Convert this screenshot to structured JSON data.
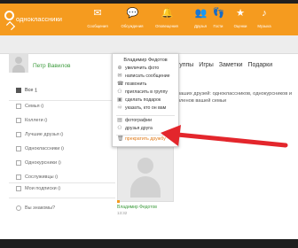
{
  "app": {
    "logo_text": "одноклассники"
  },
  "nav": [
    {
      "label": "Сообщения",
      "icon": "envelope-icon"
    },
    {
      "label": "Обсуждения",
      "icon": "chat-icon"
    },
    {
      "label": "Оповещения",
      "icon": "bell-icon"
    },
    {
      "label": "Друзья",
      "icon": "friends-icon"
    },
    {
      "label": "Гости",
      "icon": "footprints-icon"
    },
    {
      "label": "Оценки",
      "icon": "star-icon"
    },
    {
      "label": "Музыка",
      "icon": "music-icon"
    }
  ],
  "profile": {
    "name": "Петр Вавилов",
    "tabs": [
      "Группы",
      "Игры",
      "Заметки",
      "Подарки"
    ]
  },
  "left_panel": {
    "items": [
      {
        "label": "Все",
        "count": "1",
        "active": true
      },
      {
        "label": "Семья",
        "count": "0",
        "active": false
      },
      {
        "label": "Коллеги",
        "count": "0",
        "active": false
      },
      {
        "label": "Лучшие друзья",
        "count": "0",
        "active": false
      },
      {
        "label": "Одноклассники",
        "count": "0",
        "active": false
      },
      {
        "label": "Однокурсники",
        "count": "0",
        "active": false
      },
      {
        "label": "Сослуживцы",
        "count": "0",
        "active": false
      }
    ],
    "subscriptions": {
      "label": "Мои подписки",
      "count": "0"
    },
    "know_them": {
      "label": "Вы знакомы?"
    }
  },
  "main": {
    "hint": "ваших друзей: одноклассников, однокурсников и членов вашей семьи",
    "friend": {
      "name": "Владимир Федотов",
      "time": "13:32"
    }
  },
  "popup": {
    "title": "Владимир Федотов",
    "items": [
      {
        "label": "увеличить фото",
        "icon": "zoom-icon"
      },
      {
        "label": "написать сообщение",
        "icon": "message-icon"
      },
      {
        "label": "позвонить",
        "icon": "phone-icon"
      },
      {
        "label": "пригласить в группу",
        "icon": "group-icon"
      },
      {
        "label": "сделать подарок",
        "icon": "gift-icon"
      },
      {
        "label": "указать, кто он вам",
        "icon": "link-icon"
      },
      {
        "label": "фотографии",
        "icon": "photo-icon"
      },
      {
        "label": "друзья друга",
        "icon": "friends-icon"
      },
      {
        "label": "прекратить дружбу",
        "icon": "trash-icon"
      }
    ]
  },
  "colors": {
    "brand": "#f59b1f",
    "link_green": "#3c9b3c",
    "arrow_red": "#e3262c",
    "danger_link": "#e07b1a"
  }
}
